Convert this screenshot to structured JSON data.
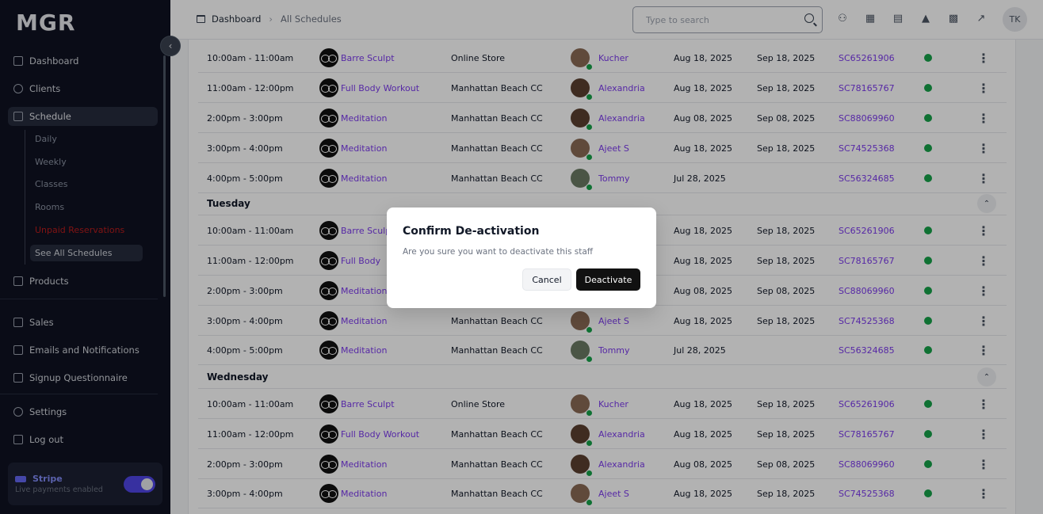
{
  "app": {
    "logo": "MGR"
  },
  "sidebar": {
    "items": [
      {
        "label": "Dashboard"
      },
      {
        "label": "Clients"
      },
      {
        "label": "Schedule"
      },
      {
        "label": "Products"
      },
      {
        "label": "Sales"
      },
      {
        "label": "Emails and Notifications"
      },
      {
        "label": "Signup Questionnaire"
      },
      {
        "label": "Settings"
      },
      {
        "label": "Log out"
      }
    ],
    "schedule_sub": [
      {
        "label": "Daily"
      },
      {
        "label": "Weekly"
      },
      {
        "label": "Classes"
      },
      {
        "label": "Rooms"
      },
      {
        "label": "Unpaid Reservations"
      },
      {
        "label": "See All Schedules"
      }
    ],
    "stripe": {
      "title": "Stripe",
      "subtitle": "Live payments enabled",
      "enabled": true
    }
  },
  "header": {
    "breadcrumb": [
      "Dashboard",
      "All Schedules"
    ],
    "search_placeholder": "Type to search",
    "avatar_initials": "TK",
    "icons": [
      "add-user-icon",
      "calendar-icon",
      "cart-icon",
      "bell-icon",
      "qr-code-icon",
      "chart-icon"
    ]
  },
  "table": {
    "rows_top": [
      {
        "time": "10:00am - 11:00am",
        "class": "Barre Sculpt",
        "location": "Online Store",
        "staff": "Kucher",
        "start": "Aug 18, 2025",
        "end": "Sep 18, 2025",
        "code": "SC65261906"
      },
      {
        "time": "11:00am - 12:00pm",
        "class": "Full Body Workout",
        "location": "Manhattan Beach CC",
        "staff": "Alexandria",
        "start": "Aug 18, 2025",
        "end": "Sep 18, 2025",
        "code": "SC78165767"
      },
      {
        "time": "2:00pm - 3:00pm",
        "class": "Meditation",
        "location": "Manhattan Beach CC",
        "staff": "Alexandria",
        "start": "Aug 08, 2025",
        "end": "Sep 08, 2025",
        "code": "SC88069960"
      },
      {
        "time": "3:00pm - 4:00pm",
        "class": "Meditation",
        "location": "Manhattan Beach CC",
        "staff": "Ajeet S",
        "start": "Aug 18, 2025",
        "end": "Sep 18, 2025",
        "code": "SC74525368"
      },
      {
        "time": "4:00pm - 5:00pm",
        "class": "Meditation",
        "location": "Manhattan Beach CC",
        "staff": "Tommy",
        "start": "Jul 28, 2025",
        "end": "",
        "code": "SC56324685"
      }
    ],
    "day_tuesday": "Tuesday",
    "rows_tuesday": [
      {
        "time": "10:00am - 11:00am",
        "class": "Barre Sculpt",
        "start": "Aug 18, 2025",
        "end": "Sep 18, 2025",
        "code": "SC65261906"
      },
      {
        "time": "11:00am - 12:00pm",
        "class": "Full Body",
        "start": "Aug 18, 2025",
        "end": "Sep 18, 2025",
        "code": "SC78165767"
      },
      {
        "time": "2:00pm - 3:00pm",
        "class": "Meditation",
        "start": "Aug 08, 2025",
        "end": "Sep 08, 2025",
        "code": "SC88069960"
      },
      {
        "time": "3:00pm - 4:00pm",
        "class": "Meditation",
        "location": "Manhattan Beach CC",
        "staff": "Ajeet S",
        "start": "Aug 18, 2025",
        "end": "Sep 18, 2025",
        "code": "SC74525368"
      },
      {
        "time": "4:00pm - 5:00pm",
        "class": "Meditation",
        "location": "Manhattan Beach CC",
        "staff": "Tommy",
        "start": "Jul 28, 2025",
        "end": "",
        "code": "SC56324685"
      }
    ],
    "day_wednesday": "Wednesday",
    "rows_wednesday": [
      {
        "time": "10:00am - 11:00am",
        "class": "Barre Sculpt",
        "location": "Online Store",
        "staff": "Kucher",
        "start": "Aug 18, 2025",
        "end": "Sep 18, 2025",
        "code": "SC65261906"
      },
      {
        "time": "11:00am - 12:00pm",
        "class": "Full Body Workout",
        "location": "Manhattan Beach CC",
        "staff": "Alexandria",
        "start": "Aug 18, 2025",
        "end": "Sep 18, 2025",
        "code": "SC78165767"
      },
      {
        "time": "2:00pm - 3:00pm",
        "class": "Meditation",
        "location": "Manhattan Beach CC",
        "staff": "Alexandria",
        "start": "Aug 08, 2025",
        "end": "Sep 08, 2025",
        "code": "SC88069960"
      },
      {
        "time": "3:00pm - 4:00pm",
        "class": "Meditation",
        "location": "Manhattan Beach CC",
        "staff": "Ajeet S",
        "start": "Aug 18, 2025",
        "end": "Sep 18, 2025",
        "code": "SC74525368"
      }
    ]
  },
  "modal": {
    "title": "Confirm De-activation",
    "message": "Are you sure you want to deactivate this staff",
    "cancel_label": "Cancel",
    "confirm_label": "Deactivate"
  },
  "colors": {
    "sidebar_bg": "#0f1222",
    "link": "#7c3aed",
    "status_active": "#16a34a",
    "accent": "#4f46e5"
  }
}
